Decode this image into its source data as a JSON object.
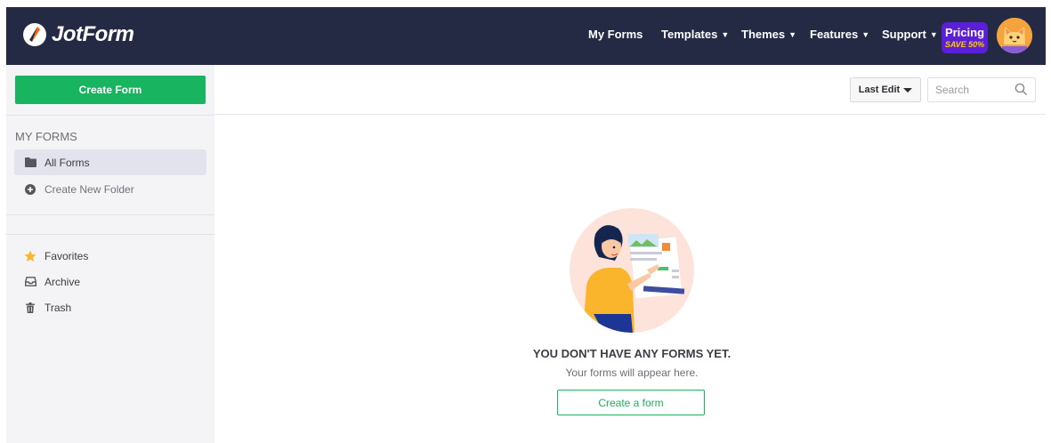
{
  "header": {
    "logo_text": "JotForm",
    "nav": [
      {
        "label": "My Forms",
        "caret": false
      },
      {
        "label": "Templates",
        "caret": true
      },
      {
        "label": "Themes",
        "caret": true
      },
      {
        "label": "Features",
        "caret": true
      },
      {
        "label": "Support",
        "caret": true
      }
    ],
    "pricing": {
      "title": "Pricing",
      "badge": "SAVE 50%"
    },
    "colors": {
      "bar": "#242a43",
      "pricing": "#5b1fd8",
      "accent": "#18b45f"
    }
  },
  "sidebar": {
    "create_label": "Create Form",
    "section_title": "MY FORMS",
    "folders": [
      {
        "label": "All Forms",
        "icon": "folder-icon",
        "active": true
      },
      {
        "label": "Create New Folder",
        "icon": "plus-circle-icon",
        "active": false
      }
    ],
    "extras": [
      {
        "label": "Favorites",
        "icon": "star-icon"
      },
      {
        "label": "Archive",
        "icon": "inbox-icon"
      },
      {
        "label": "Trash",
        "icon": "trash-icon"
      }
    ]
  },
  "toolbar": {
    "sort_label": "Last Edit",
    "search_placeholder": "Search"
  },
  "empty": {
    "title": "YOU DON'T HAVE ANY FORMS YET.",
    "subtitle": "Your forms will appear here.",
    "button": "Create a form"
  }
}
